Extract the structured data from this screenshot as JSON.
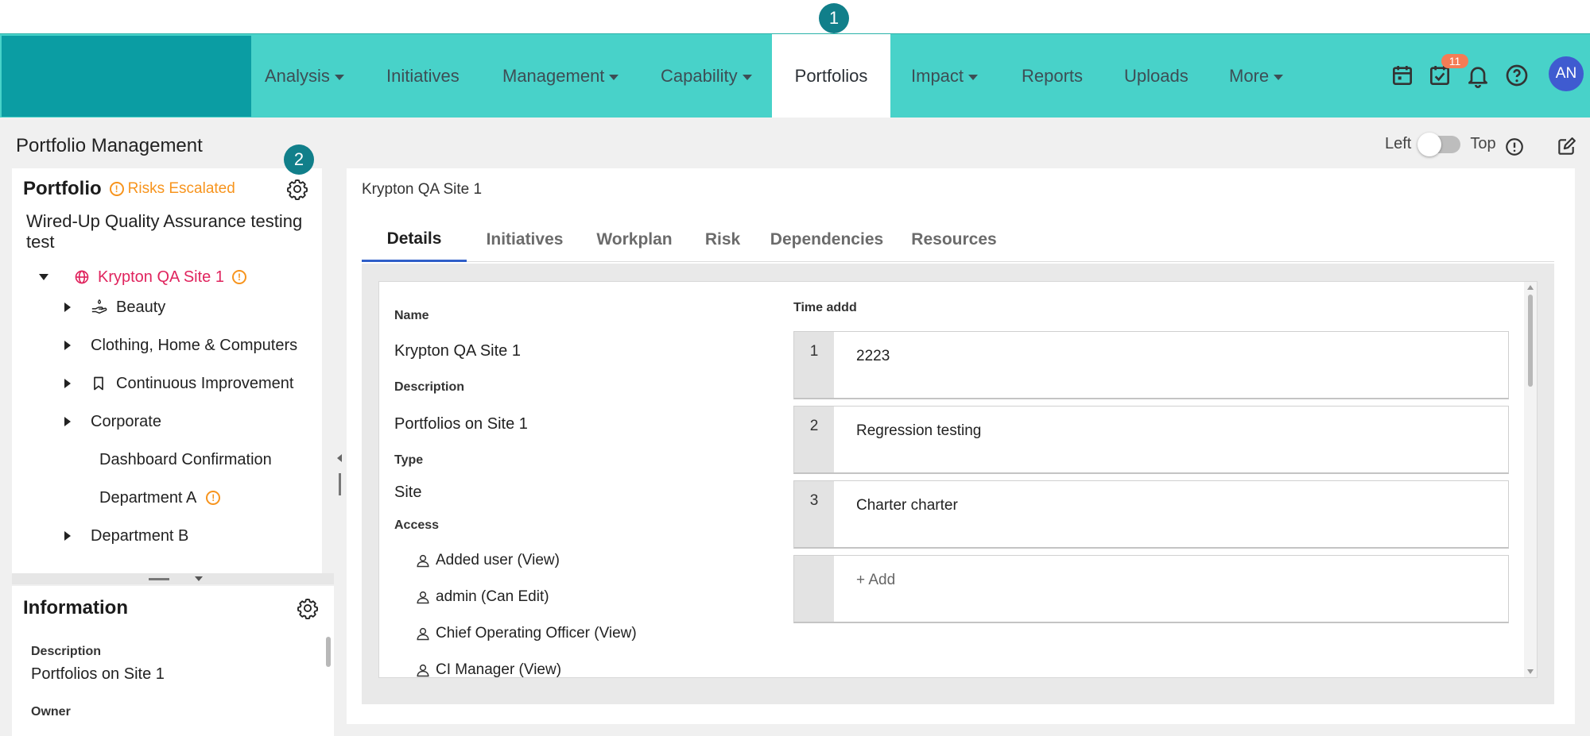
{
  "markers": {
    "first": "1",
    "second": "2"
  },
  "nav": {
    "items": [
      {
        "label": "Analysis",
        "dropdown": true
      },
      {
        "label": "Initiatives",
        "dropdown": false
      },
      {
        "label": "Management",
        "dropdown": true
      },
      {
        "label": "Capability",
        "dropdown": true
      },
      {
        "label": "Portfolios",
        "dropdown": false,
        "active": true
      },
      {
        "label": "Impact",
        "dropdown": true
      },
      {
        "label": "Reports",
        "dropdown": false
      },
      {
        "label": "Uploads",
        "dropdown": false
      },
      {
        "label": "More",
        "dropdown": true
      }
    ],
    "icons": [
      "calendar-icon",
      "task-check-icon",
      "bell-icon",
      "help-icon"
    ],
    "task_badge": "11",
    "avatar_initials": "AN"
  },
  "page": {
    "title": "Portfolio Management",
    "toggle_left": "Left",
    "toggle_right": "Top"
  },
  "portfolio": {
    "title": "Portfolio",
    "risk_label": "Risks Escalated",
    "name": "Wired-Up Quality Assurance testing test",
    "root": {
      "label": "Krypton QA Site 1"
    },
    "children": [
      {
        "label": "Beauty",
        "expandable": true,
        "icon": "hand-icon"
      },
      {
        "label": "Clothing, Home & Computers",
        "expandable": true
      },
      {
        "label": "Continuous Improvement",
        "expandable": true,
        "icon": "bookmark-icon"
      },
      {
        "label": "Corporate",
        "expandable": true
      },
      {
        "label": "Dashboard Confirmation",
        "expandable": false
      },
      {
        "label": "Department A",
        "expandable": false,
        "warning": true
      },
      {
        "label": "Department B",
        "expandable": true
      }
    ]
  },
  "information": {
    "title": "Information",
    "description_label": "Description",
    "description_value": "Portfolios on Site 1",
    "owner_label": "Owner"
  },
  "main": {
    "breadcrumb": "Krypton QA Site 1",
    "tabs": [
      "Details",
      "Initiatives",
      "Workplan",
      "Risk",
      "Dependencies",
      "Resources"
    ],
    "details": {
      "name_label": "Name",
      "name_value": "Krypton QA Site 1",
      "description_label": "Description",
      "description_value": "Portfolios on Site 1",
      "type_label": "Type",
      "type_value": "Site",
      "access_label": "Access",
      "access": [
        "Added user (View)",
        "admin (Can Edit)",
        "Chief Operating Officer (View)",
        "CI Manager (View)"
      ]
    },
    "time": {
      "title": "Time addd",
      "rows": [
        {
          "num": "1",
          "text": "2223"
        },
        {
          "num": "2",
          "text": "Regression testing"
        },
        {
          "num": "3",
          "text": "Charter charter"
        }
      ],
      "add_label": "+ Add"
    }
  },
  "colors": {
    "nav_bg": "#48d2c9",
    "logo_bg": "#0b9da3",
    "marker": "#117f8a",
    "risk": "#f7941d",
    "root_node": "#e0245e",
    "active_tab": "#2f5fc9",
    "avatar": "#3f5bd0",
    "badge": "#f47c55"
  }
}
